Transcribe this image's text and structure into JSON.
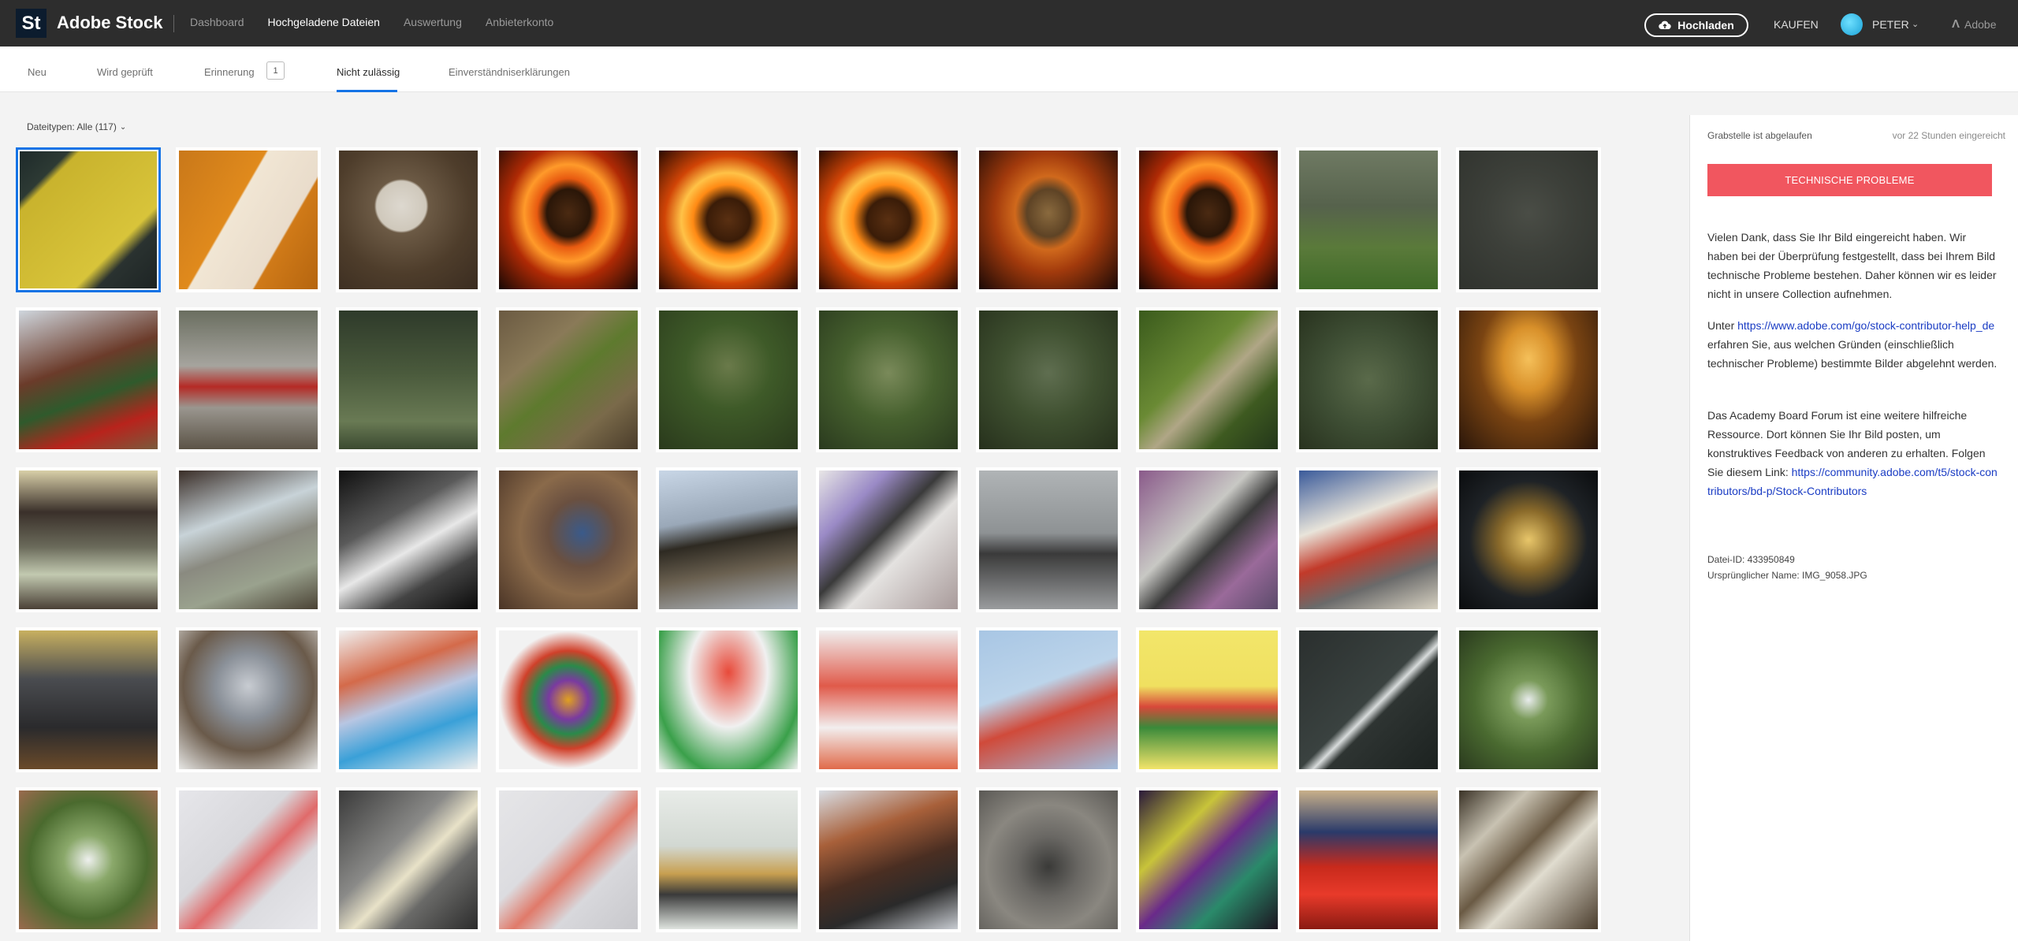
{
  "app": {
    "logo_text": "St",
    "title": "Adobe Stock"
  },
  "topnav": [
    "Dashboard",
    "Hochgeladene Dateien",
    "Auswertung",
    "Anbieterkonto"
  ],
  "header_right": {
    "upload_label": "Hochladen",
    "kaufen": "KAUFEN",
    "user": "PETER",
    "adobe": "Adobe"
  },
  "tabs": [
    "Neu",
    "Wird geprüft",
    "Erinnerung",
    "Nicht zulässig",
    "Einverständniserklärungen"
  ],
  "tab_badge": "1",
  "filter": "Dateitypen: Alle (117)",
  "panel": {
    "status": "Grabstelle ist abgelaufen",
    "time": "vor 22 Stunden eingereicht",
    "problem_button": "TECHNISCHE PROBLEME",
    "para1": "Vielen Dank, dass Sie Ihr Bild eingereicht haben. Wir haben bei der Überprüfung festgestellt, dass bei Ihrem Bild technische Probleme bestehen. Daher können wir es leider nicht in unsere Collection aufnehmen.",
    "para2_pre": "Unter ",
    "para2_link": "https://www.adobe.com/go/stock-contributor-help_de",
    "para2_post": " erfahren Sie, aus welchen Gründen (einschließlich technischer Probleme) bestimmte Bilder abgelehnt werden.",
    "para3": "Das Academy Board Forum ist eine weitere hilfreiche Ressource. Dort können Sie Ihr Bild posten, um konstruktives Feedback von anderen zu erhalten. Folgen Sie diesem Link:",
    "para3_link": "https://community.adobe.com/t5/stock-contributors/bd-p/Stock-Contributors",
    "file_id": "Datei-ID: 433950849",
    "original_name": "Ursprünglicher Name: IMG_9058.JPG"
  },
  "colors": {
    "accent": "#1473e6",
    "problem": "#f1565f",
    "topbar": "#2d2d2d"
  },
  "thumbnails": [
    {
      "name": "grave-sign",
      "bg": "linear-gradient(135deg,#1e2a2a 0%,#2d3a34 18%,#c9b32d 22%,#d8c43a 70%,#2a3230 78%,#1d2424 100%)"
    },
    {
      "name": "door-handle",
      "bg": "linear-gradient(120deg,#c9781a 0%,#e08a1c 40%,#f1e6d4 41%,#e9dccb 70%,#d07a18 71%,#b5650f 100%)"
    },
    {
      "name": "lock-sign",
      "bg": "radial-gradient(circle at 45% 40%,#ddd8cf 0%,#cfc8bb 22%,#6c5a45 24%,#4e3d2b 60%,#3a2c20 100%)"
    },
    {
      "name": "coffin-fire-1",
      "bg": "radial-gradient(ellipse at 50% 45%,#4b2a12 0%,#2a1608 22%,#e85a10 32%,#ff9a2a 45%,#b02a05 62%,#170805 100%)"
    },
    {
      "name": "coffin-fire-2",
      "bg": "radial-gradient(ellipse at 50% 50%,#5a3012 0%,#3a1c08 22%,#ff8a14 36%,#ffc247 48%,#d04406 65%,#2a0c02 100%)"
    },
    {
      "name": "coffin-fire-3",
      "bg": "radial-gradient(ellipse at 50% 50%,#5a3012 0%,#3a1c08 22%,#ff8a14 36%,#ffc247 48%,#d04406 65%,#2a0c02 100%)"
    },
    {
      "name": "coffin-fire-4",
      "bg": "radial-gradient(ellipse at 50% 45%,#8a6a3e 0%,#5e4325 22%,#d0691c 34%,#a23a0c 55%,#1a0906 100%)"
    },
    {
      "name": "coffin-fire-5",
      "bg": "radial-gradient(ellipse at 50% 45%,#4b2a12 0%,#2a1608 22%,#e85a10 32%,#ff9a2a 45%,#b02a05 62%,#170805 100%)"
    },
    {
      "name": "graveyard-1",
      "bg": "linear-gradient(180deg,#6f7a63 0%,#56624c 40%,#5a7a3a 70%,#3f6a28 100%)"
    },
    {
      "name": "skull-relief",
      "bg": "radial-gradient(circle at 50% 45%,#4a4d46 0%,#3d403a 40%,#2f322d 100%)"
    },
    {
      "name": "xmas-wreath",
      "bg": "linear-gradient(160deg,#cfd6dd 0%,#6b3b2a 40%,#2f5a2c 60%,#b8231c 80%,#7a5a3c 100%)"
    },
    {
      "name": "grave-lantern",
      "bg": "linear-gradient(180deg,#6a6e60 0%,#a6a49e 40%,#b52a25 55%,#9a968f 70%,#5b5346 100%)"
    },
    {
      "name": "graveyard-2",
      "bg": "linear-gradient(180deg,#2e3a2a 0%,#4a5a3c 45%,#697a54 80%,#3b4a30 100%)"
    },
    {
      "name": "mossy-grave",
      "bg": "linear-gradient(140deg,#6b5a42 0%,#8a7a58 30%,#5e7a2e 50%,#7a6a4a 75%,#4a3c2a 100%)"
    },
    {
      "name": "moss-ornament-1",
      "bg": "radial-gradient(circle at 50% 40%,#6a7a4a 0%,#3e5a28 40%,#2a3a1c 100%)"
    },
    {
      "name": "moss-ornament-2",
      "bg": "radial-gradient(circle at 50% 45%,#7a8a5a 0%,#46602e 45%,#2a3a1e 100%)"
    },
    {
      "name": "moss-ornament-3",
      "bg": "radial-gradient(circle at 50% 45%,#5f6e50 0%,#3f5030 45%,#26301c 100%)"
    },
    {
      "name": "moss-stone",
      "bg": "linear-gradient(135deg,#3a5a1c 0%,#6a8a34 40%,#b0a686 55%,#3e5a20 75%,#23361a 100%)"
    },
    {
      "name": "moss-relief",
      "bg": "radial-gradient(circle at 50% 50%,#5a6a4a 0%,#3e4e34 50%,#28321e 100%)"
    },
    {
      "name": "lamp-warm",
      "bg": "radial-gradient(ellipse at 50% 35%,#f5c05a 0%,#d8902a 25%,#7a4412 50%,#2a160a 100%)"
    },
    {
      "name": "armchair-lamp",
      "bg": "linear-gradient(180deg,#d8cfa8 0%,#3a302a 30%,#6a6a5a 55%,#c2c9b0 75%,#4a4036 100%)"
    },
    {
      "name": "living-room",
      "bg": "linear-gradient(160deg,#3a2e28 0%,#c8d3d8 35%,#8a8a80 55%,#9aa28e 75%,#4a4234 100%)"
    },
    {
      "name": "bw-room",
      "bg": "linear-gradient(150deg,#101010 0%,#5a5a5a 35%,#e8e8e8 55%,#444 75%,#0a0a0a 100%)"
    },
    {
      "name": "snails-market",
      "bg": "radial-gradient(circle at 60% 45%,#3a5a8a 0%,#6a5040 30%,#8a6a4a 55%,#4a3426 100%)"
    },
    {
      "name": "metropolitain",
      "bg": "linear-gradient(170deg,#c8d6e6 0%,#9aa8b8 35%,#2e2a22 50%,#6a6050 70%,#b0b8c2 100%)"
    },
    {
      "name": "graffiti-wall",
      "bg": "linear-gradient(135deg,#e8e6e6 0%,#9a8ac6 25%,#3a3a3a 45%,#e4e2e0 60%,#a89a9a 100%)"
    },
    {
      "name": "bicycle",
      "bg": "linear-gradient(180deg,#b0b4b6 0%,#8e9294 45%,#3a3a3a 60%,#9a9c9e 100%)"
    },
    {
      "name": "stormtrooper",
      "bg": "linear-gradient(135deg,#8a5a8a 0%,#c8c8c4 40%,#3a3a3a 55%,#9a6a9a 75%,#5a4a6a 100%)"
    },
    {
      "name": "street-art",
      "bg": "linear-gradient(160deg,#3a5a9a 0%,#e8e4da 35%,#c23a2a 55%,#6a6a6a 75%,#d8d2c2 100%)"
    },
    {
      "name": "alarm-sign",
      "bg": "radial-gradient(ellipse at 50% 50%,#e8c66a 0%,#8a6a2a 30%,#1e2226 60%,#0a0c0e 100%)"
    },
    {
      "name": "sofa",
      "bg": "linear-gradient(180deg,#c8b060 0%,#4a4c50 35%,#2a2a2c 70%,#6a4a2a 100%)"
    },
    {
      "name": "dried-flowers",
      "bg": "radial-gradient(circle at 50% 40%,#c8ccd2 0%,#8a9098 30%,#6a5a4a 60%,#e6e6e4 100%)"
    },
    {
      "name": "chalk-drawing",
      "bg": "linear-gradient(160deg,#f0f0f0 0%,#d46a4a 30%,#b8c6e2 50%,#3aa0d8 70%,#eeeeee 100%)"
    },
    {
      "name": "paint-splash",
      "bg": "radial-gradient(circle at 50% 50%,#e0a020 0%,#7a3aa0 20%,#2a8a4a 35%,#d0402a 50%,#f2f2f2 70%)"
    },
    {
      "name": "mushroom-drawing",
      "bg": "radial-gradient(ellipse at 50% 30%,#e84a3a 0%,#f0f0f0 40%,#3aa04a 75%,#f0f0f0 100%)"
    },
    {
      "name": "red-drawing",
      "bg": "linear-gradient(180deg,#f0eeee 0%,#e05a4a 40%,#f2eeee 70%,#e06a4a 100%)"
    },
    {
      "name": "bird-drawing",
      "bg": "linear-gradient(160deg,#a8c6e4 0%,#bcd4ea 40%,#d04a3a 60%,#a2bede 100%)"
    },
    {
      "name": "kid-drawing",
      "bg": "linear-gradient(180deg,#f2e66a 0%,#f0e060 40%,#d8483a 55%,#3a8a3a 70%,#f2e46a 100%)"
    },
    {
      "name": "syringe-dark",
      "bg": "linear-gradient(135deg,#2a2f2e 0%,#3a4240 50%,#d8dcdc 55%,#2e3432 60%,#1c2220 100%)"
    },
    {
      "name": "syringe-green",
      "bg": "radial-gradient(circle at 50% 50%,#e8ecec 0%,#7a9a5a 20%,#4a6a30 55%,#2a3a1e 100%)"
    },
    {
      "name": "syringe-hand",
      "bg": "radial-gradient(circle at 50% 50%,#eef0ee 0%,#8aa86a 25%,#4a6a2e 60%,#9a6a4e 100%)"
    },
    {
      "name": "vaccine-paper",
      "bg": "linear-gradient(135deg,#e6e6ea 0%,#d8d8dc 40%,#e06a6a 55%,#dcdce0 70%,#e8e8ec 100%)"
    },
    {
      "name": "syringe-table",
      "bg": "linear-gradient(135deg,#3a3a3a 0%,#8a8a88 40%,#e8e2c8 55%,#6a6a68 70%,#2c2c2c 100%)"
    },
    {
      "name": "covid-paper",
      "bg": "linear-gradient(135deg,#e6e6e8 0%,#dcdce0 40%,#e07a6a 55%,#d8d8dc 70%,#c8c8cc 100%)"
    },
    {
      "name": "chairs-table",
      "bg": "linear-gradient(180deg,#e8ece8 0%,#d2d8d2 40%,#c8a050 60%,#3a3a3a 75%,#dfe4df 100%)"
    },
    {
      "name": "buildings",
      "bg": "linear-gradient(160deg,#d8dde4 0%,#a8603a 30%,#4a2e22 55%,#2a2a2a 75%,#c8ccd2 100%)"
    },
    {
      "name": "squirrel",
      "bg": "radial-gradient(circle at 50% 55%,#3a3a38 0%,#6a6864 30%,#8a8780 60%,#5a5854 100%)"
    },
    {
      "name": "wire-baskets",
      "bg": "linear-gradient(135deg,#2a1a3a 0%,#c8c43a 30%,#6a2a8a 50%,#2a8a6a 70%,#1c1420 100%)"
    },
    {
      "name": "tomatoes",
      "bg": "linear-gradient(180deg,#c8b08a 0%,#2a3a6a 30%,#c82a1c 55%,#e83a2a 75%,#8a1a12 100%)"
    },
    {
      "name": "stairs-metal",
      "bg": "linear-gradient(135deg,#3a3226 0%,#c8c2b2 25%,#6a5a44 45%,#e0dccf 60%,#4a3c2c 100%)"
    }
  ]
}
